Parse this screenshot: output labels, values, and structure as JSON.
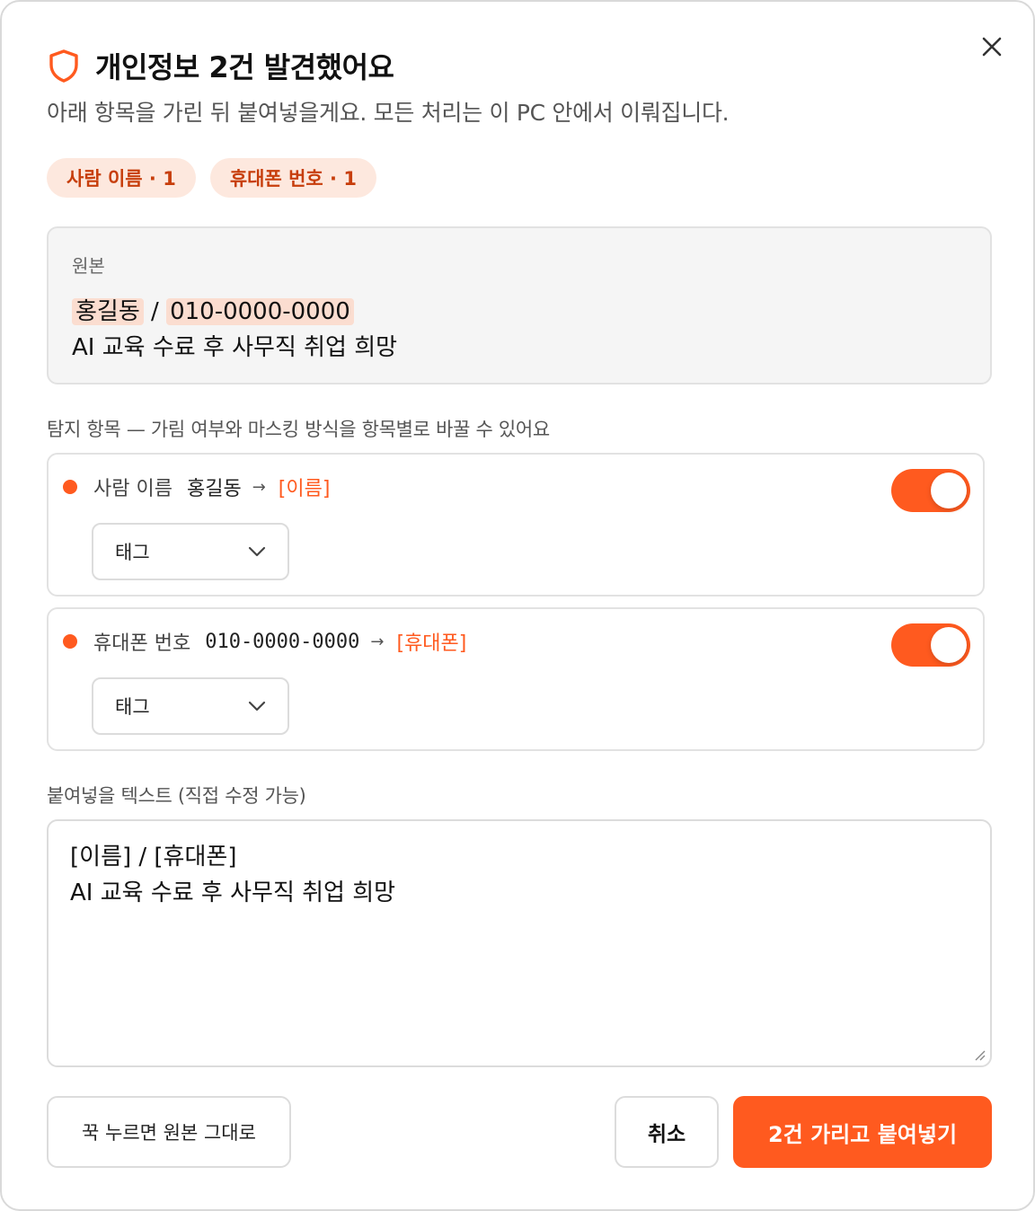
{
  "dialog": {
    "title": "개인정보 2건 발견했어요",
    "subtitle": "아래 항목을 가린 뒤 붙여넣을게요. 모든 처리는 이 PC 안에서 이뤄집니다.",
    "close_icon": "close-icon",
    "shield_icon": "shield-icon",
    "accent_color": "#ff5a1f"
  },
  "chips": [
    {
      "label": "사람 이름 · 1"
    },
    {
      "label": "휴대폰 번호 · 1"
    }
  ],
  "original": {
    "label": "원본",
    "name": "홍길동",
    "separator": " / ",
    "phone": "010-0000-0000",
    "line2": "AI 교육 수료 후 사무직 취업 희망"
  },
  "detected": {
    "label": "탐지 항목 — 가림 여부와 마스킹 방식을 항목별로 바꿀 수 있어요",
    "items": [
      {
        "type": "사람 이름",
        "value": "홍길동",
        "arrow": "→",
        "replacement": "[이름]",
        "enabled": true,
        "mode": "태그"
      },
      {
        "type": "휴대폰 번호",
        "value": "010-0000-0000",
        "arrow": "→",
        "replacement": "[휴대폰]",
        "enabled": true,
        "mode": "태그"
      }
    ]
  },
  "paste": {
    "label": "붙여넣을 텍스트 (직접 수정 가능)",
    "value": "[이름] / [휴대폰]\nAI 교육 수료 후 사무직 취업 희망"
  },
  "buttons": {
    "hold_label": "꾹 누르면 원본 그대로",
    "cancel_label": "취소",
    "primary_label": "2건 가리고 붙여넣기"
  }
}
